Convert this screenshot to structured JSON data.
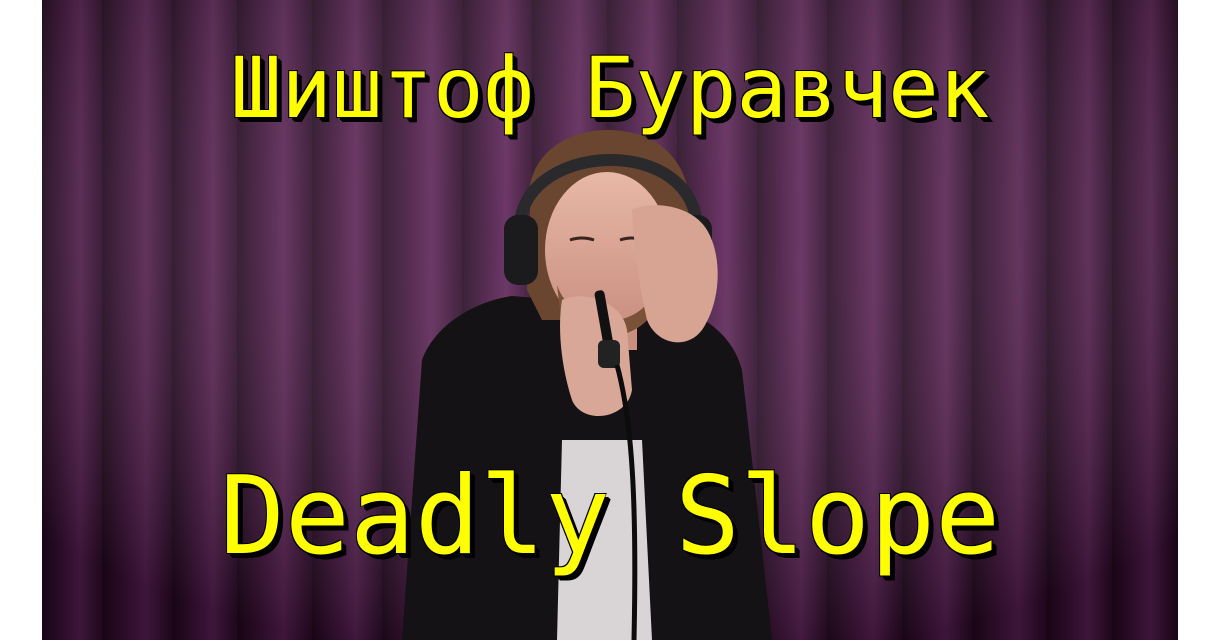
{
  "overlay_text": {
    "artist_name": "Шиштоф Буравчек",
    "song_title": "Deadly Slope"
  },
  "colors": {
    "caption_fill": "#ffff00",
    "caption_shadow": "#000000",
    "curtain_base": "#3a0f35",
    "curtain_highlight": "#5b1f55",
    "side_bars": "#ffffff"
  },
  "scene": {
    "subject": "person-with-headphones-singing-into-microphone",
    "background": "purple-curtain"
  }
}
